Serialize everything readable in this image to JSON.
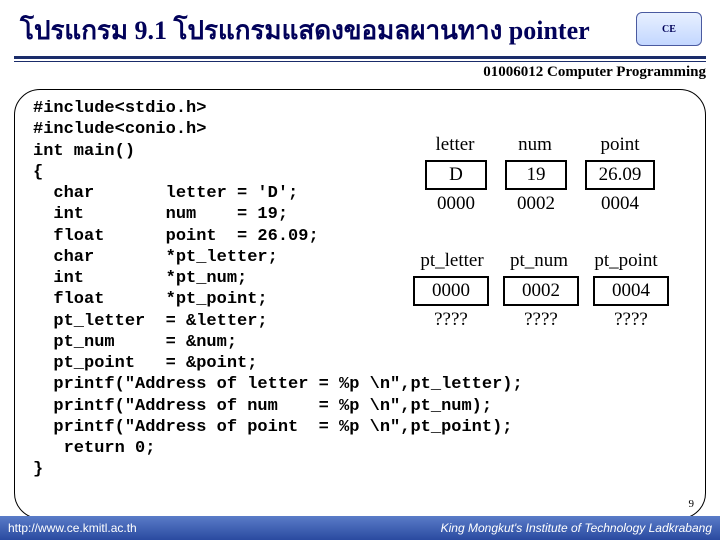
{
  "header": {
    "title": "โปรแกรม 9.1 โปรแกรมแสดงขอมลผานทาง pointer",
    "logo_text": "CE",
    "course": "01006012 Computer Programming"
  },
  "code": {
    "l01": "#include<stdio.h>",
    "l02": "#include<conio.h>",
    "l03": "int main()",
    "l04": "{",
    "l05": "  char       letter = 'D';",
    "l06": "  int        num    = 19;",
    "l07": "  float      point  = 26.09;",
    "l08": "  char       *pt_letter;",
    "l09": "  int        *pt_num;",
    "l10": "  float      *pt_point;",
    "l11": "  pt_letter  = &letter;",
    "l12": "  pt_num     = &num;",
    "l13": "  pt_point   = &point;",
    "l14": "  printf(\"Address of letter = %p \\n\",pt_letter);",
    "l15": "  printf(\"Address of num    = %p \\n\",pt_num);",
    "l16": "  printf(\"Address of point  = %p \\n\",pt_point);",
    "l17": "   return 0;",
    "l18": "}"
  },
  "diagram": {
    "row1_labels": {
      "a": "letter",
      "b": "num",
      "c": "point"
    },
    "row1_values": {
      "a": "D",
      "b": "19",
      "c": "26.09"
    },
    "row1_addrs": {
      "a": "0000",
      "b": "0002",
      "c": "0004"
    },
    "row2_labels": {
      "a": "pt_letter",
      "b": "pt_num",
      "c": "pt_point"
    },
    "row2_values": {
      "a": "0000",
      "b": "0002",
      "c": "0004"
    },
    "row2_addrs": {
      "a": "????",
      "b": "????",
      "c": "????"
    }
  },
  "footer": {
    "url": "http://www.ce.kmitl.ac.th",
    "inst": "King Mongkut's Institute of Technology Ladkrabang",
    "page": "9"
  }
}
